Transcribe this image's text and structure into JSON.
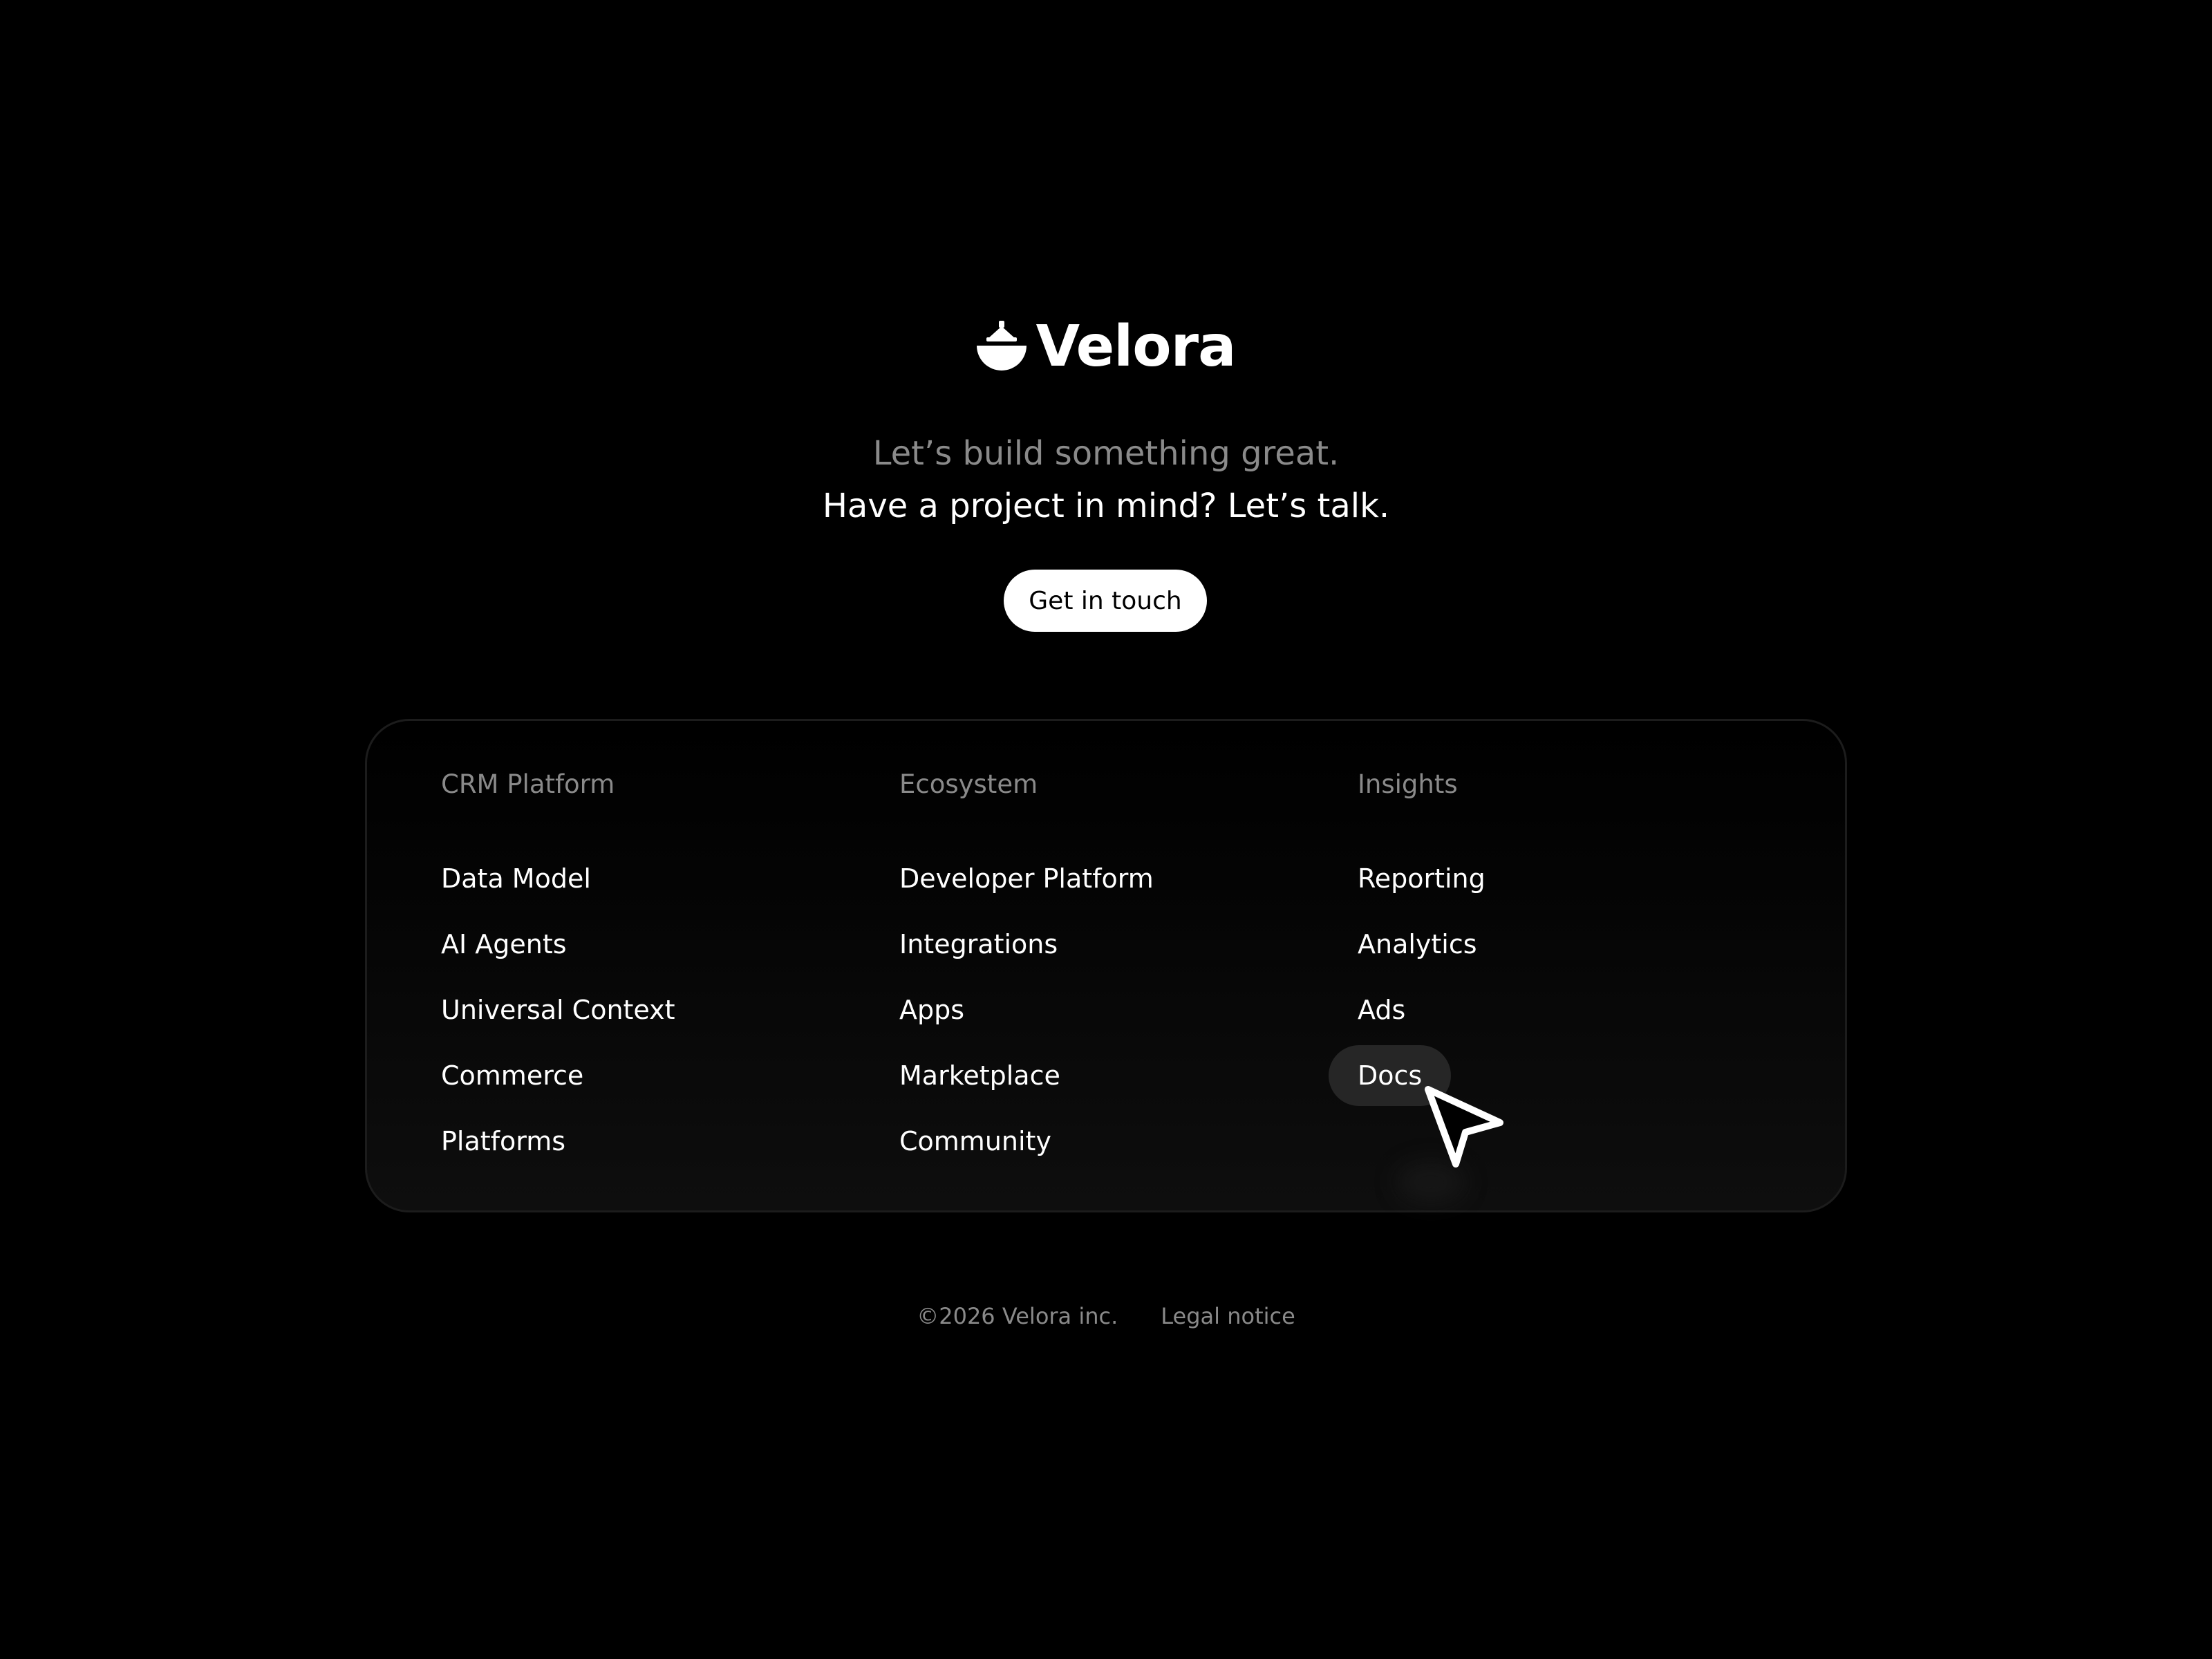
{
  "brand": {
    "name": "Velora",
    "logo_icon": "velora-logo-icon"
  },
  "hero": {
    "tagline": "Let’s build something great.",
    "subline": "Have a project in mind? Let’s talk.",
    "cta_label": "Get in touch"
  },
  "footer_nav": {
    "columns": [
      {
        "heading": "CRM Platform",
        "links": [
          "Data Model",
          "AI Agents",
          "Universal Context",
          "Commerce",
          "Platforms"
        ]
      },
      {
        "heading": "Ecosystem",
        "links": [
          "Developer Platform",
          "Integrations",
          "Apps",
          "Marketplace",
          "Community"
        ]
      },
      {
        "heading": "Insights",
        "links": [
          "Reporting",
          "Analytics",
          "Ads",
          "Docs"
        ]
      }
    ],
    "hovered_link": "Docs"
  },
  "bottom_bar": {
    "copyright": "©2026 Velora inc.",
    "legal_label": "Legal notice"
  },
  "cursor": {
    "icon": "pointer-cursor-icon"
  },
  "colors": {
    "background": "#000000",
    "text_primary": "#ffffff",
    "text_muted": "#8a8a8a",
    "hover_pill": "#262626"
  }
}
